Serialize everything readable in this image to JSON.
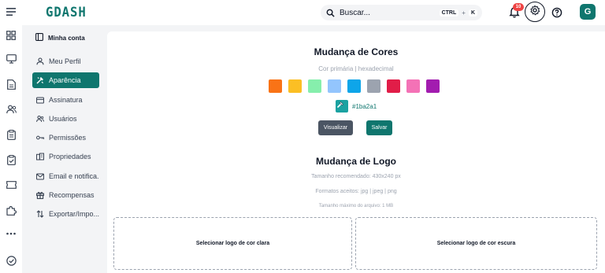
{
  "brand": {
    "logo_text": "GDASH",
    "accent": "#0f766e"
  },
  "search": {
    "placeholder": "Buscar...",
    "shortcut_key1": "CTRL",
    "shortcut_plus": "+",
    "shortcut_key2": "K"
  },
  "notifications": {
    "count": "10"
  },
  "avatar": {
    "initial": "G"
  },
  "rail_icons": [
    "dashboard-icon",
    "monitor-icon",
    "document-icon",
    "users-icon",
    "clipboard-icon",
    "clipboard-check-icon",
    "ticket-icon",
    "puzzle-icon",
    "more-icon",
    "check-circle-icon"
  ],
  "sidebar": {
    "header": "Minha conta",
    "items": [
      {
        "label": "Meu Perfil",
        "icon": "user-icon",
        "active": false
      },
      {
        "label": "Aparência",
        "icon": "palette-icon",
        "active": true
      },
      {
        "label": "Assinatura",
        "icon": "card-icon",
        "active": false
      },
      {
        "label": "Usuários",
        "icon": "users-icon",
        "active": false
      },
      {
        "label": "Permissões",
        "icon": "key-icon",
        "active": false
      },
      {
        "label": "Propriedades",
        "icon": "building-icon",
        "active": false
      },
      {
        "label": "Email e notifica...",
        "icon": "mail-icon",
        "active": false
      },
      {
        "label": "Recompensas",
        "icon": "gift-icon",
        "active": false
      },
      {
        "label": "Exportar/Impo...",
        "icon": "transfer-icon",
        "active": false
      }
    ]
  },
  "colors_section": {
    "title": "Mudança de Cores",
    "subtitle": "Cor primária | hexadecimal",
    "swatches": [
      "#f97316",
      "#fbbf24",
      "#86efac",
      "#93c5fd",
      "#0ea5e9",
      "#9ca3af",
      "#e11d48",
      "#f472b6",
      "#a21caf"
    ],
    "current_hex": "#1ba2a1",
    "current_color": "#1ba2a1",
    "preview_label": "Visualizar",
    "save_label": "Salvar"
  },
  "logo_section": {
    "title": "Mudança de Logo",
    "recommended_size": "Tamanho recomendado: 430x240 px",
    "accepted_formats": "Formatos aceitos: jpg | jpeg | png",
    "max_size": "Tamanho máximo do arquivo: 1 MB",
    "light_logo_label": "Selecionar logo de cor clara",
    "dark_logo_label": "Selecionar logo de cor escura"
  }
}
